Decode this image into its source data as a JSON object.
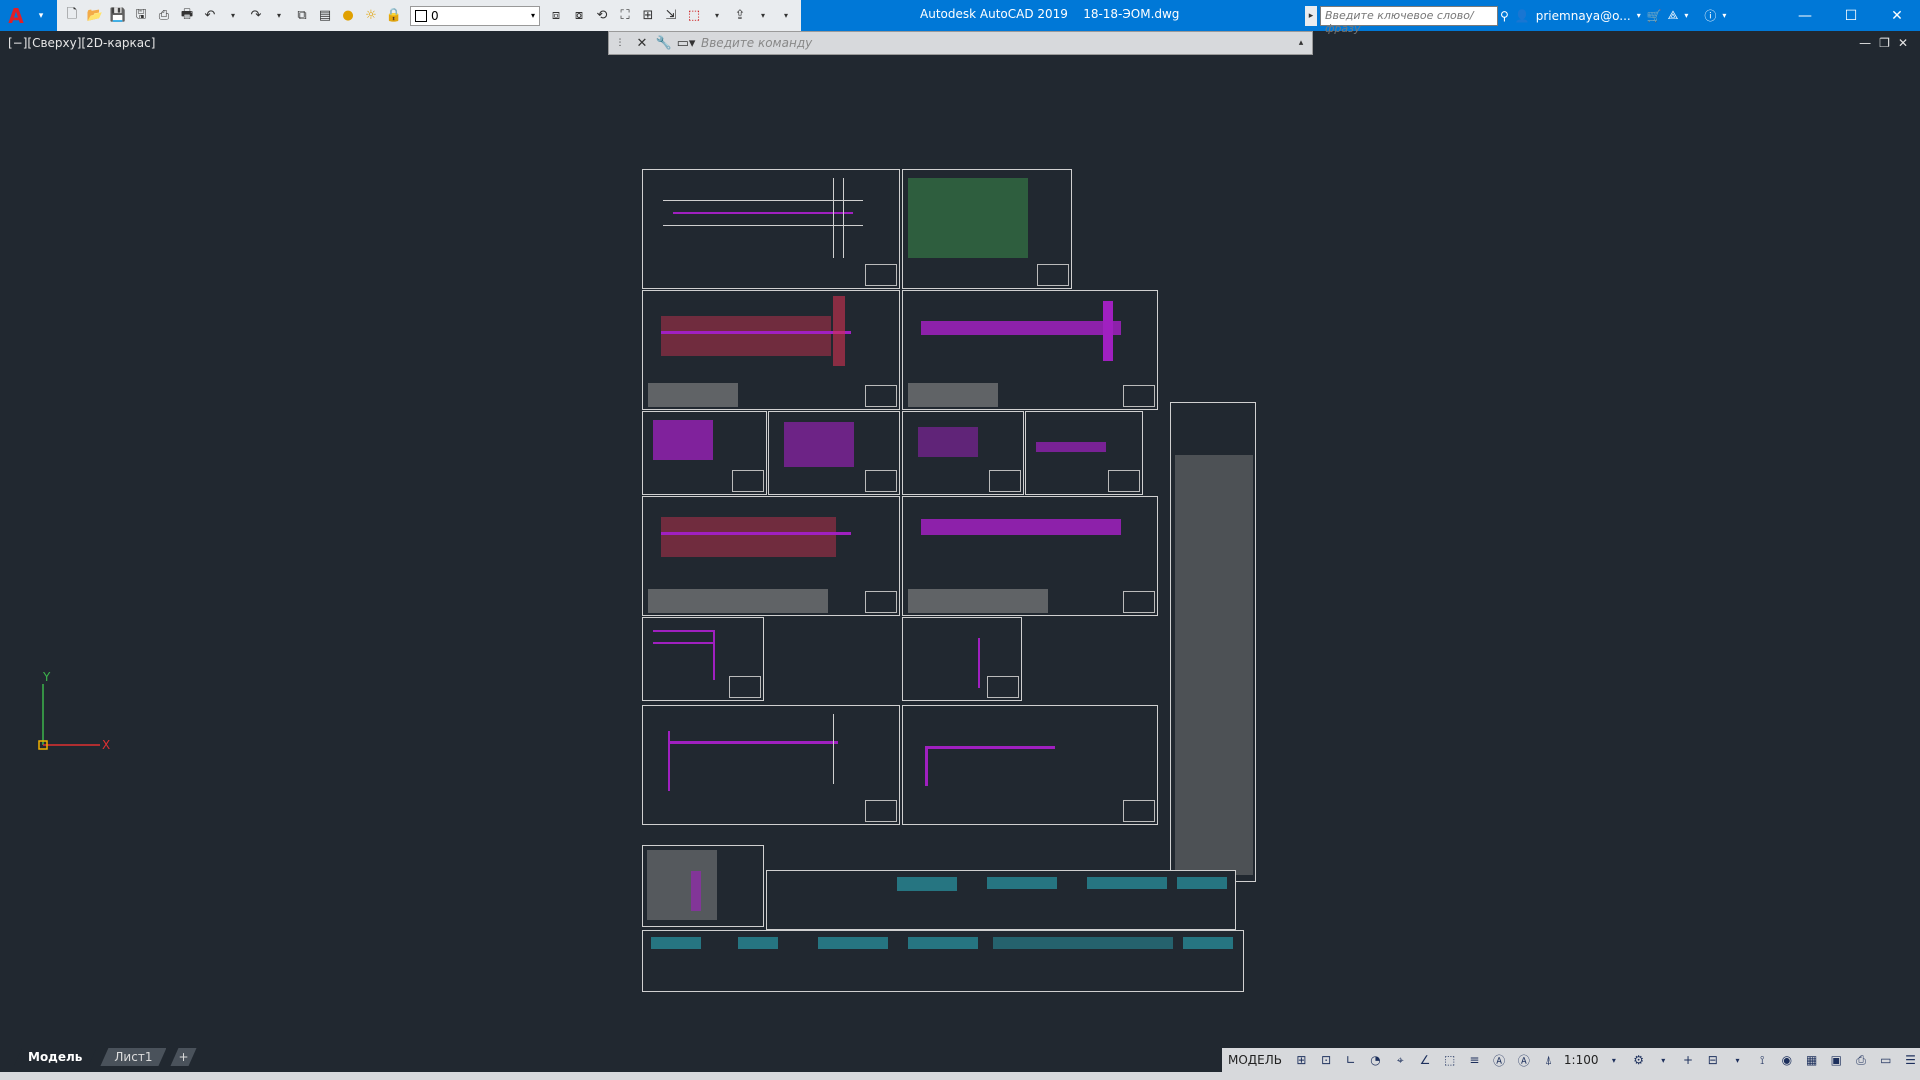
{
  "app": {
    "title": "Autodesk AutoCAD 2019",
    "filename": "18-18-ЭОМ.dwg",
    "logo_letter": "A"
  },
  "quick_access": {
    "icons": [
      "new-icon",
      "open-icon",
      "save-icon",
      "save-as-icon",
      "publish-icon",
      "plot-icon",
      "undo-icon",
      "redo-icon",
      "match-icon",
      "layer-icon"
    ],
    "layer_value": "0"
  },
  "search": {
    "placeholder": "Введите ключевое слово/фразу"
  },
  "user": {
    "name": "priemnaya@o..."
  },
  "window_controls": {
    "minimize": "—",
    "maximize": "☐",
    "close": "✕"
  },
  "viewport": {
    "label": "[−][Сверху][2D-каркас]",
    "controls": [
      "—",
      "❐",
      "✕"
    ]
  },
  "command_line": {
    "placeholder": "Введите команду"
  },
  "ucs": {
    "x_label": "X",
    "y_label": "Y"
  },
  "tabs": [
    {
      "label": "Модель",
      "active": true
    },
    {
      "label": "Лист1",
      "active": false
    }
  ],
  "tab_add": "+",
  "status_bar": {
    "mode": "МОДЕЛЬ",
    "scale": "1:100"
  },
  "colors": {
    "accent": "#0078d7",
    "canvas": "#212830",
    "magenta": "#a020c0",
    "red": "#d03050"
  }
}
